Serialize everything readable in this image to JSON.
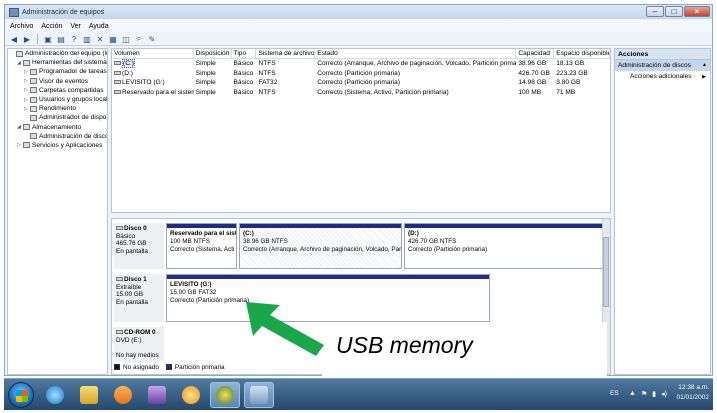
{
  "window": {
    "title": "Administración de equipos"
  },
  "menu": [
    "Archivo",
    "Acción",
    "Ver",
    "Ayuda"
  ],
  "tree": [
    {
      "label": "Administración del equipo (loc",
      "level": 0,
      "twisty": ""
    },
    {
      "label": "Herramientas del sistema",
      "level": 1,
      "twisty": "◢"
    },
    {
      "label": "Programador de tareas",
      "level": 2,
      "twisty": "▷"
    },
    {
      "label": "Visor de eventos",
      "level": 2,
      "twisty": "▷"
    },
    {
      "label": "Carpetas compartidas",
      "level": 2,
      "twisty": "▷"
    },
    {
      "label": "Usuarios y grupos locale",
      "level": 2,
      "twisty": "▷"
    },
    {
      "label": "Rendimiento",
      "level": 2,
      "twisty": "▷"
    },
    {
      "label": "Administrador de dispo",
      "level": 2,
      "twisty": ""
    },
    {
      "label": "Almacenamiento",
      "level": 1,
      "twisty": "◢"
    },
    {
      "label": "Administración de disco",
      "level": 2,
      "twisty": ""
    },
    {
      "label": "Servicios y Aplicaciones",
      "level": 1,
      "twisty": "▷"
    }
  ],
  "volumes": {
    "headers": [
      "Volumen",
      "Disposición",
      "Tipo",
      "Sistema de archivos",
      "Estado",
      "Capacidad",
      "Espacio disponible"
    ],
    "rows": [
      [
        "(C:)",
        "Simple",
        "Básico",
        "NTFS",
        "Correcto (Arranque, Archivo de paginación, Volcado, Partición primaria)",
        "38.96 GB",
        "18.13 GB"
      ],
      [
        "(D:)",
        "Simple",
        "Básico",
        "NTFS",
        "Correcto (Partición primaria)",
        "426.70 GB",
        "223.23 GB"
      ],
      [
        "LEVISITO (G:)",
        "Simple",
        "Básico",
        "FAT32",
        "Correcto (Partición primaria)",
        "14.98 GB",
        "3.80 GB"
      ],
      [
        "Reservado para el sistema",
        "Simple",
        "Básico",
        "NTFS",
        "Correcto (Sistema, Activo, Partición primaria)",
        "100 MB",
        "71 MB"
      ]
    ]
  },
  "disks": [
    {
      "name": "Disco 0",
      "type": "Básico",
      "size": "465.76 GB",
      "status": "En pantalla",
      "partitions": [
        {
          "name": "Reservado para el sist",
          "info": "100 MB NTFS",
          "status": "Correcto (Sistema, Acti"
        },
        {
          "name": "(C:)",
          "info": "38.96 GB NTFS",
          "status": "Correcto (Arranque, Archivo de paginación, Volcado, Part"
        },
        {
          "name": "(D:)",
          "info": "426.70 GB NTFS",
          "status": "Correcto (Partición primaria)"
        }
      ]
    },
    {
      "name": "Disco 1",
      "type": "Extraíble",
      "size": "15.00 GB",
      "status": "En pantalla",
      "partitions": [
        {
          "name": "LEVISITO (G:)",
          "info": "15.00 GB FAT32",
          "status": "Correcto (Partición primaria)"
        }
      ]
    },
    {
      "name": "CD-ROM 0",
      "type": "DVD (E:)",
      "size": "",
      "status": "No hay medios",
      "partitions": []
    }
  ],
  "legend": {
    "unallocated": "No asignado",
    "primary": "Partición primaria",
    "unallocated_color": "#111111",
    "primary_color": "#1d2d85"
  },
  "actions": {
    "header": "Acciones",
    "section": "Administración de discos",
    "item": "Acciones adicionales"
  },
  "annotation": {
    "text": "USB memory",
    "arrow_color": "#1aa64a"
  },
  "taskbar": {
    "language": "ES",
    "time": "12:38 a.m.",
    "date": "01/01/2002"
  }
}
